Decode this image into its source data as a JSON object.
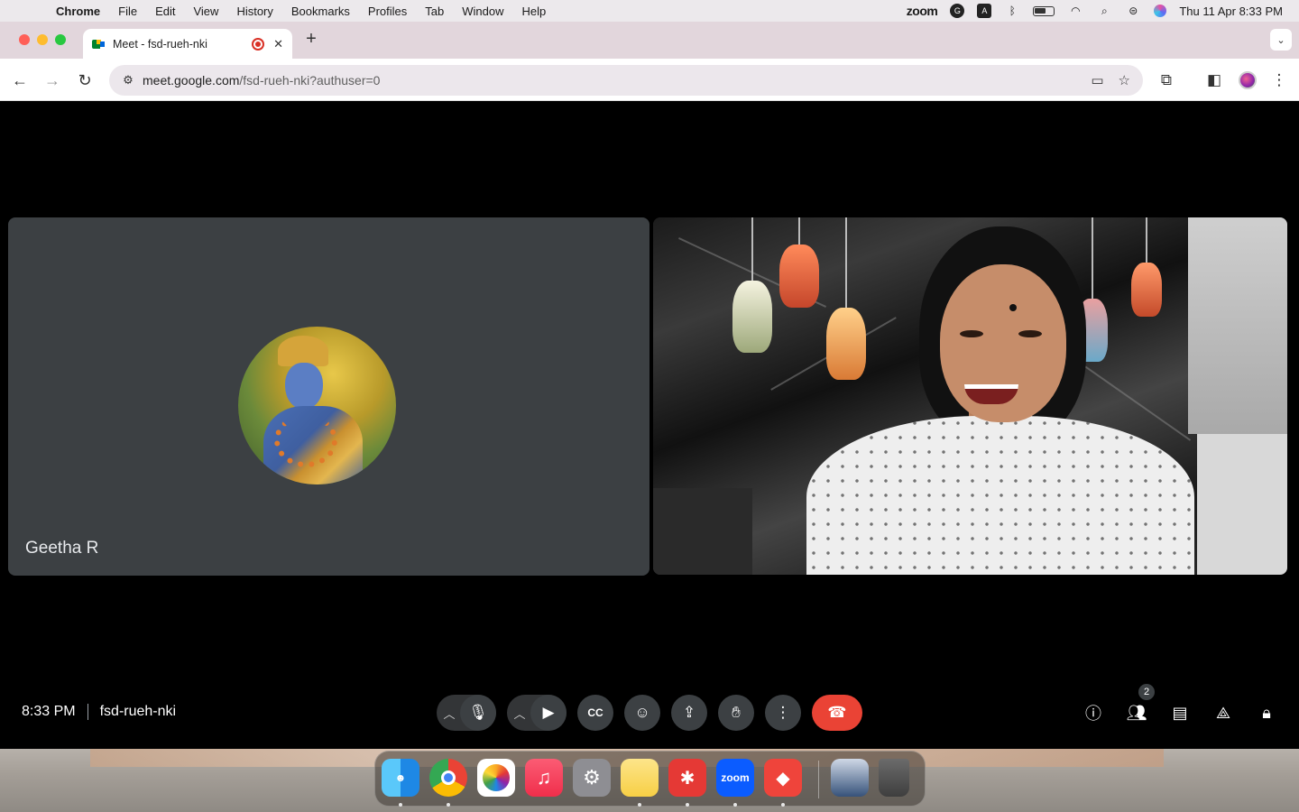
{
  "menubar": {
    "app_name": "Chrome",
    "items": [
      "File",
      "Edit",
      "View",
      "History",
      "Bookmarks",
      "Profiles",
      "Tab",
      "Window",
      "Help"
    ],
    "status": {
      "zoom_label": "zoom",
      "datetime": "Thu 11 Apr  8:33 PM"
    }
  },
  "browser": {
    "tab_title": "Meet - fsd-rueh-nki",
    "url_domain": "meet.google.com",
    "url_path": "/fsd-rueh-nki?authuser=0"
  },
  "meet": {
    "participants": [
      {
        "name": "Geetha R",
        "video_on": false
      },
      {
        "name": "",
        "video_on": true
      }
    ],
    "time": "8:33 PM",
    "meeting_code": "fsd-rueh-nki",
    "people_count": "2",
    "colors": {
      "end_call": "#ea4335",
      "tile_bg": "#3c4043",
      "control_bg": "#3c4043"
    }
  },
  "dock": {
    "apps": [
      "Finder",
      "Chrome",
      "Photos",
      "Music",
      "System Settings",
      "Notes",
      "Xmind",
      "Zoom",
      "AnyDesk",
      "Screenshot",
      "Trash"
    ],
    "zoom_label": "zoom"
  }
}
